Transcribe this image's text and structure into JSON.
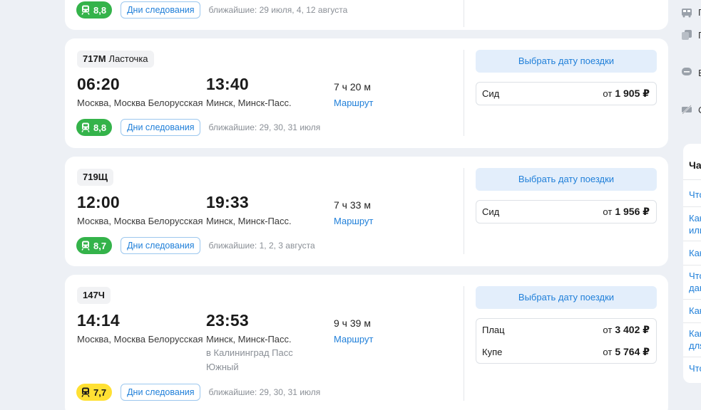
{
  "top_card": {
    "rating": "8,8",
    "days_label": "Дни следования",
    "nearest": "ближайшие: 29 июля, 4, 12 августа"
  },
  "trains": [
    {
      "number": "717М",
      "name": "Ласточка",
      "depart_time": "06:20",
      "depart_station": "Москва, Москва Белорусская",
      "arrive_time": "13:40",
      "arrive_station": "Минск, Минск-Пасс.",
      "arrive_sub": "",
      "duration": "7 ч 20 м",
      "route_label": "Маршрут",
      "rating": "8,8",
      "rating_color": "#34b34a",
      "days_label": "Дни следования",
      "nearest": "ближайшие: 29, 30, 31 июля",
      "pick_label": "Выбрать дату поездки",
      "prices": [
        {
          "class": "Сид",
          "from": "от",
          "amount": "1 905 ₽"
        }
      ]
    },
    {
      "number": "719Щ",
      "name": "",
      "depart_time": "12:00",
      "depart_station": "Москва, Москва Белорусская",
      "arrive_time": "19:33",
      "arrive_station": "Минск, Минск-Пасс.",
      "arrive_sub": "",
      "duration": "7 ч 33 м",
      "route_label": "Маршрут",
      "rating": "8,7",
      "rating_color": "#34b34a",
      "days_label": "Дни следования",
      "nearest": "ближайшие: 1, 2, 3 августа",
      "pick_label": "Выбрать дату поездки",
      "prices": [
        {
          "class": "Сид",
          "from": "от",
          "amount": "1 956 ₽"
        }
      ]
    },
    {
      "number": "147Ч",
      "name": "",
      "depart_time": "14:14",
      "depart_station": "Москва, Москва Белорусская",
      "arrive_time": "23:53",
      "arrive_station": "Минск, Минск-Пасс.",
      "arrive_sub": "в Калининград Пасс Южный",
      "duration": "9 ч 39 м",
      "route_label": "Маршрут",
      "rating": "7,7",
      "rating_color": "#ffe033",
      "days_label": "Дни следования",
      "nearest": "ближайшие: 29, 30, 31 июля",
      "pick_label": "Выбрать дату поездки",
      "prices": [
        {
          "class": "Плац",
          "from": "от",
          "amount": "3 402 ₽"
        },
        {
          "class": "Купе",
          "from": "от",
          "amount": "5 764 ₽"
        }
      ]
    }
  ],
  "right_panel": {
    "items": [
      {
        "icon": "bus-icon",
        "text": "П"
      },
      {
        "icon": "copy-icon",
        "text": "Г"
      },
      {
        "icon": "chat-icon",
        "text": "Е"
      },
      {
        "icon": "no-ticket-icon",
        "text": "С"
      }
    ],
    "faq_title": "Ча",
    "faq_items": [
      "Что",
      "Как",
      "или",
      "Как",
      "Что",
      "дан",
      "Как",
      "Как",
      "для",
      "Что"
    ]
  }
}
